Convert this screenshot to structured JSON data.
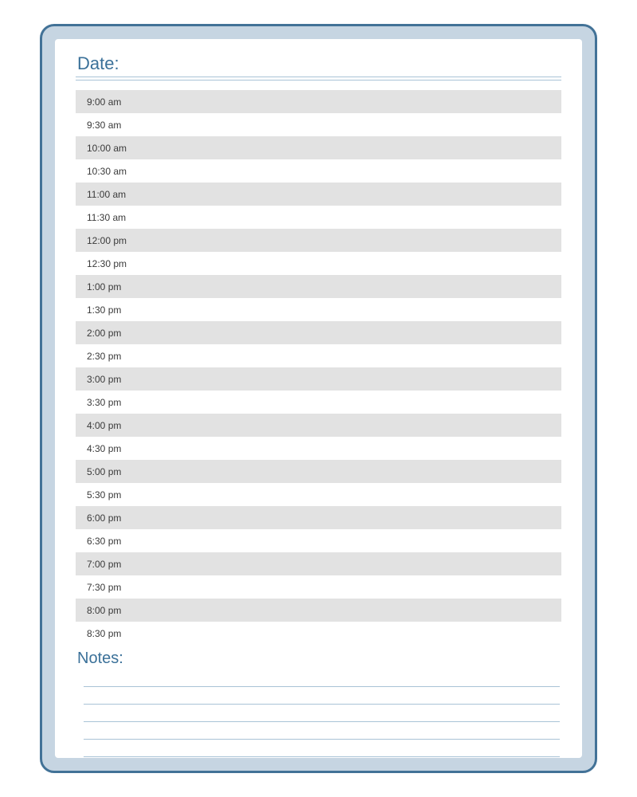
{
  "headings": {
    "date": "Date:",
    "notes": "Notes:"
  },
  "schedule": {
    "slots": [
      "9:00 am",
      "9:30 am",
      "10:00 am",
      "10:30 am",
      "11:00 am",
      "11:30 am",
      "12:00 pm",
      "12:30 pm",
      "1:00 pm",
      "1:30 pm",
      "2:00 pm",
      "2:30 pm",
      "3:00 pm",
      "3:30 pm",
      "4:00 pm",
      "4:30 pm",
      "5:00 pm",
      "5:30 pm",
      "6:00 pm",
      "6:30 pm",
      "7:00 pm",
      "7:30 pm",
      "8:00 pm",
      "8:30 pm"
    ]
  },
  "notes": {
    "line_count": 5
  },
  "colors": {
    "border": "#427297",
    "frame_fill": "#c6d5e2",
    "heading_text": "#3b7199",
    "rule_line": "#a9c3d6",
    "row_shade": "#e2e2e2"
  }
}
